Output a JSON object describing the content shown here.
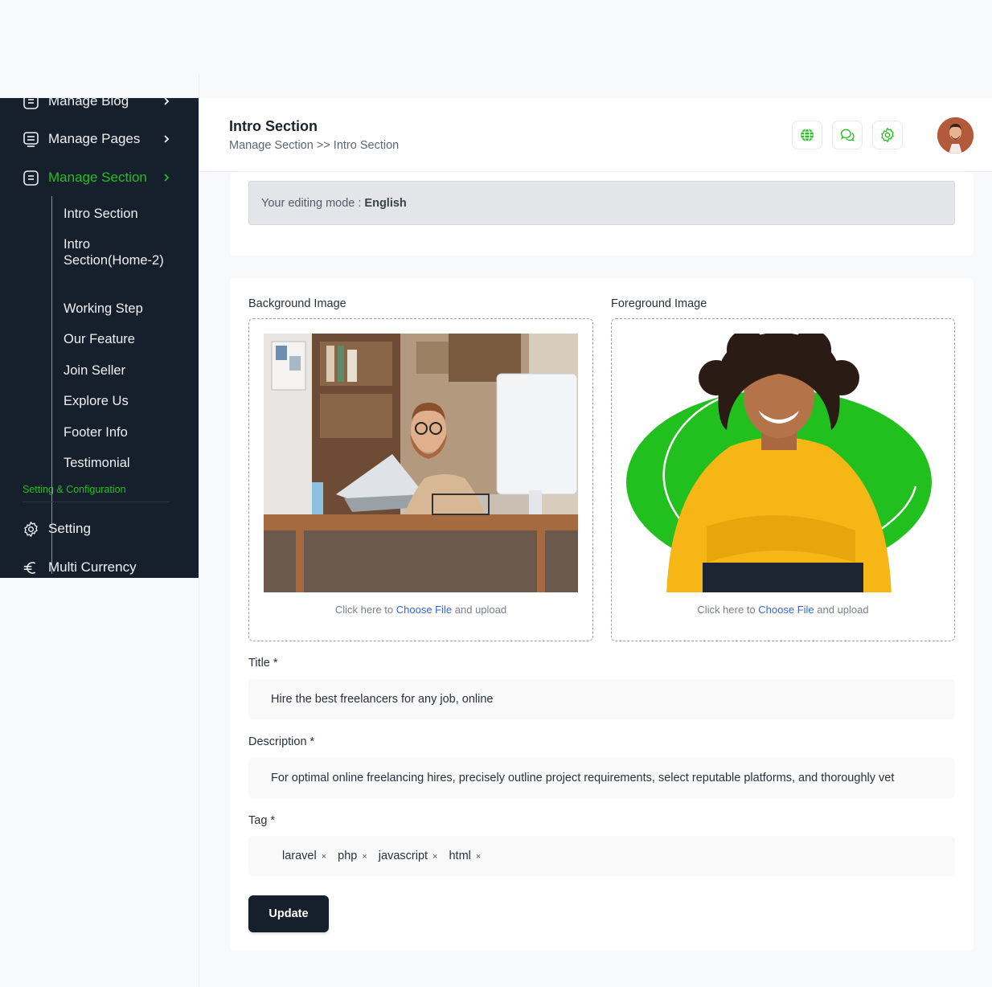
{
  "sidebar": {
    "items": [
      {
        "label": "Manage Blog",
        "icon": "blog-icon"
      },
      {
        "label": "Manage Pages",
        "icon": "pages-icon"
      },
      {
        "label": "Manage Section",
        "icon": "section-icon"
      }
    ],
    "sub_items": [
      "Intro Section",
      "Intro Section(Home-2)",
      "Working Step",
      "Our Feature",
      "Join Seller",
      "Explore Us",
      "Footer Info",
      "Testimonial"
    ],
    "caption": "Setting & Configuration",
    "bottom_items": [
      {
        "label": "Setting",
        "icon": "gear-icon"
      },
      {
        "label": "Multi Currency",
        "icon": "euro-icon"
      }
    ]
  },
  "header": {
    "title": "Intro Section",
    "breadcrumb": "Manage Section >> Intro Section",
    "icons": [
      "globe-icon",
      "chat-icon",
      "settings-icon"
    ]
  },
  "mode": {
    "prefix": "Your editing mode :",
    "language": "English"
  },
  "form": {
    "background_label": "Background Image",
    "foreground_label": "Foreground Image",
    "upload_prefix": "Click here to",
    "upload_link": "Choose File",
    "upload_suffix": "and upload",
    "title_label": "Title *",
    "title_value": "Hire the best freelancers for any job, online",
    "description_label": "Description *",
    "description_value": "For optimal online freelancing hires, precisely outline project requirements, select reputable platforms, and thoroughly vet",
    "tag_label": "Tag *",
    "tags": [
      "laravel",
      "php",
      "javascript",
      "html"
    ],
    "tag_remove": "×",
    "update_label": "Update"
  },
  "colors": {
    "sidebar_bg": "#161f2c",
    "accent": "#22c01e",
    "link": "#3566e0"
  }
}
